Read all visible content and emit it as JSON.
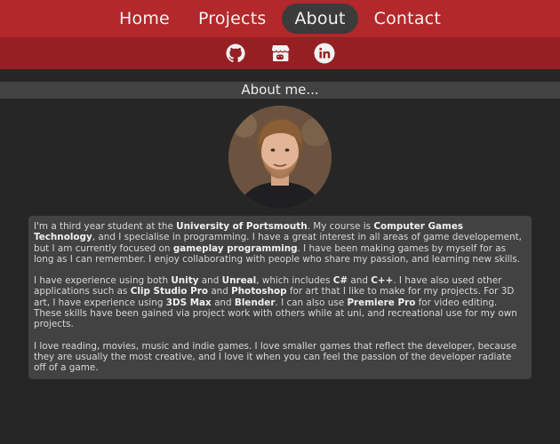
{
  "nav": {
    "items": [
      {
        "label": "Home",
        "active": false
      },
      {
        "label": "Projects",
        "active": false
      },
      {
        "label": "About",
        "active": true
      },
      {
        "label": "Contact",
        "active": false
      }
    ],
    "active_color": "#3b3b3b",
    "bar_color": "#b2282b"
  },
  "social": {
    "icons": [
      "github-icon",
      "itch-io-icon",
      "linkedin-icon"
    ],
    "bar_color": "#951f22"
  },
  "about": {
    "header": "About me...",
    "avatar": "profile-photo",
    "p1": {
      "t1": "I'm a third year student at the ",
      "b1": "University of Portsmouth",
      "t2": ". My course is ",
      "b2": "Computer Games Technology",
      "t3": ", and I specialise in programming. I have a great interest in all areas of game developement, but I am currently focused on ",
      "b3": "gameplay programming",
      "t4": ". I have been making games by myself for as long as I can remember. I enjoy collaborating with people who share my passion, and learning new skills."
    },
    "p2": {
      "t1": "I have experience using both ",
      "b1": "Unity",
      "t2": " and ",
      "b2": "Unreal",
      "t3": ", which includes ",
      "b3": "C#",
      "t4": " and ",
      "b4": "C++",
      "t5": ". I have also used other applications such as ",
      "b5": "Clip Studio Pro",
      "t6": " and ",
      "b6": "Photoshop",
      "t7": " for art that I like to make for my projects. For 3D art, I have experience using ",
      "b7": "3DS Max",
      "t8": " and ",
      "b8": "Blender",
      "t9": ". I can also use ",
      "b9": "Premiere Pro",
      "t10": " for video editing. These skills have been gained via project work with others while at uni, and recreational use for my own projects."
    },
    "p3": "I love reading, movies, music and indie games. I love smaller games that reflect the developer, because they are usually the most creative, and I love it when you can feel the passion of the developer radiate off of a game."
  }
}
